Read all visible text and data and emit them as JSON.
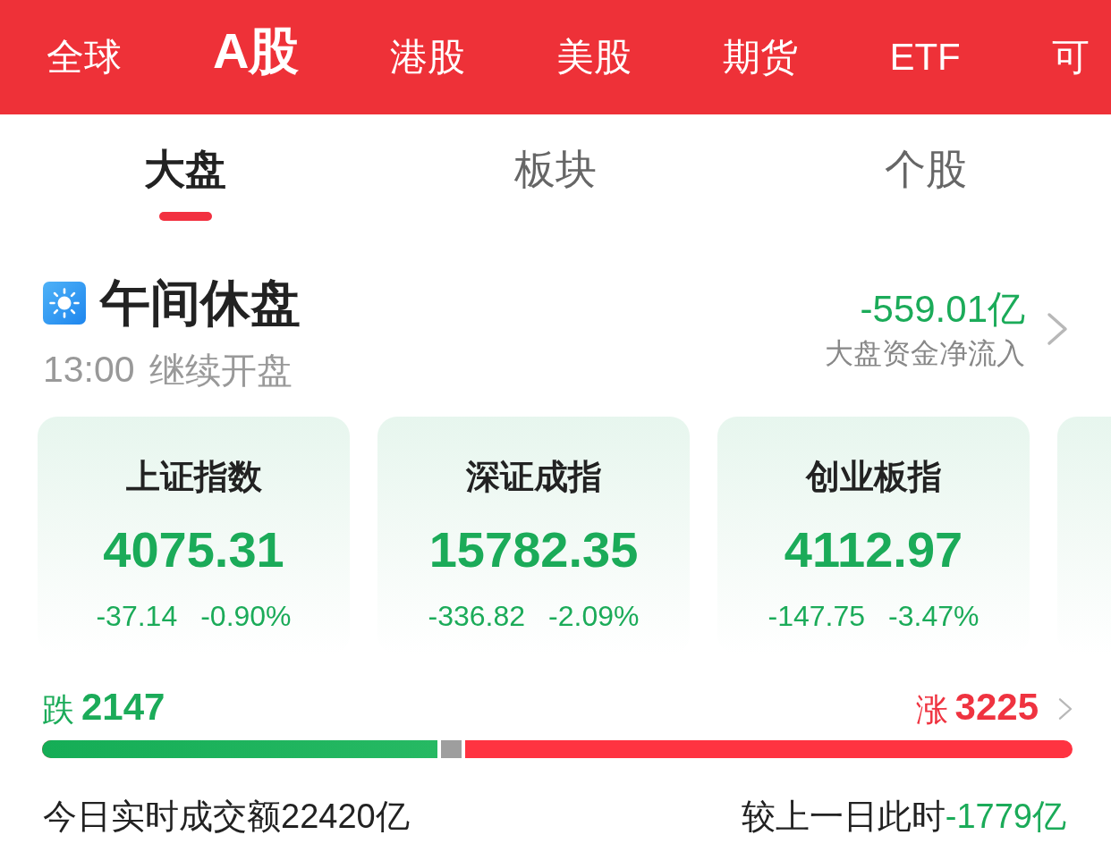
{
  "market_tabs": [
    {
      "label": "全球",
      "selected": false
    },
    {
      "label": "A股",
      "selected": true
    },
    {
      "label": "港股",
      "selected": false
    },
    {
      "label": "美股",
      "selected": false
    },
    {
      "label": "期货",
      "selected": false
    },
    {
      "label": "ETF",
      "selected": false
    },
    {
      "label": "可",
      "selected": false
    }
  ],
  "sub_tabs": [
    {
      "label": "大盘",
      "selected": true
    },
    {
      "label": "板块",
      "selected": false
    },
    {
      "label": "个股",
      "selected": false
    }
  ],
  "session": {
    "title": "午间休盘",
    "time": "13:00",
    "note": "继续开盘"
  },
  "net_flow": {
    "value": "-559.01亿",
    "label": "大盘资金净流入"
  },
  "index_cards": [
    {
      "name": "上证指数",
      "value": "4075.31",
      "change": "-37.14",
      "change_pct": "-0.90%"
    },
    {
      "name": "深证成指",
      "value": "15782.35",
      "change": "-336.82",
      "change_pct": "-2.09%"
    },
    {
      "name": "创业板指",
      "value": "4112.97",
      "change": "-147.75",
      "change_pct": "-3.47%"
    }
  ],
  "breadth": {
    "down_label": "跌",
    "down_count": "2147",
    "up_label": "涨",
    "up_count": "3225",
    "bar": [
      {
        "kind": "down",
        "level": 0.387
      },
      {
        "kind": "flat",
        "level": 0.411
      }
    ]
  },
  "turnover": {
    "label": "今日实时成交额",
    "value": "22420亿"
  },
  "comparison": {
    "label": "较上一日此时",
    "value": "-1779亿"
  }
}
